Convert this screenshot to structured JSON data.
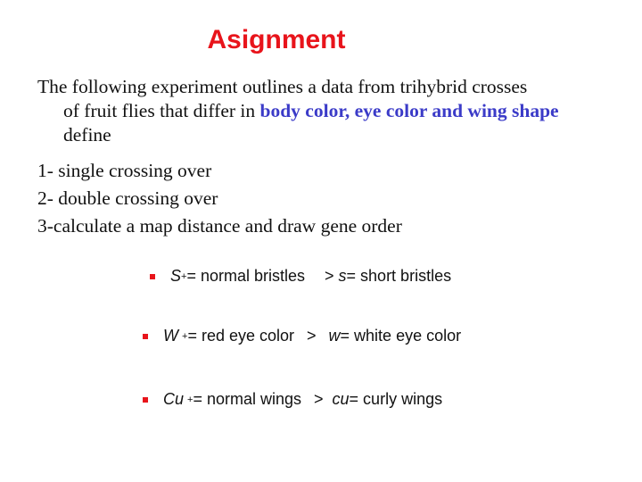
{
  "title": "Asignment",
  "intro": {
    "line1": "The following experiment outlines a data from trihybrid crosses",
    "line2_prefix": "of fruit flies that differ in ",
    "line2_highlight": "body color, eye color and wing shape",
    "line3": "define"
  },
  "tasks": [
    "1- single crossing over",
    "2- double crossing over",
    "3-calculate a map distance and  draw gene order"
  ],
  "traits": [
    {
      "dominant_symbol": "S",
      "dominant_sup": "+",
      "dominant_desc": " = normal bristles",
      "relation": ">",
      "recessive_symbol": "s",
      "recessive_desc": " = short bristles"
    },
    {
      "dominant_symbol": "W",
      "dominant_sup": "+",
      "dominant_desc": " = red eye color",
      "relation": ">",
      "recessive_symbol": "w",
      "recessive_desc": " = white eye color"
    },
    {
      "dominant_symbol": "Cu",
      "dominant_sup": "+",
      "dominant_desc": " = normal wings",
      "relation": ">",
      "recessive_symbol": "cu",
      "recessive_desc": " = curly wings"
    }
  ],
  "colors": {
    "title": "#e8141b",
    "highlight": "#3b3bc8",
    "bullet": "#e8141b"
  }
}
